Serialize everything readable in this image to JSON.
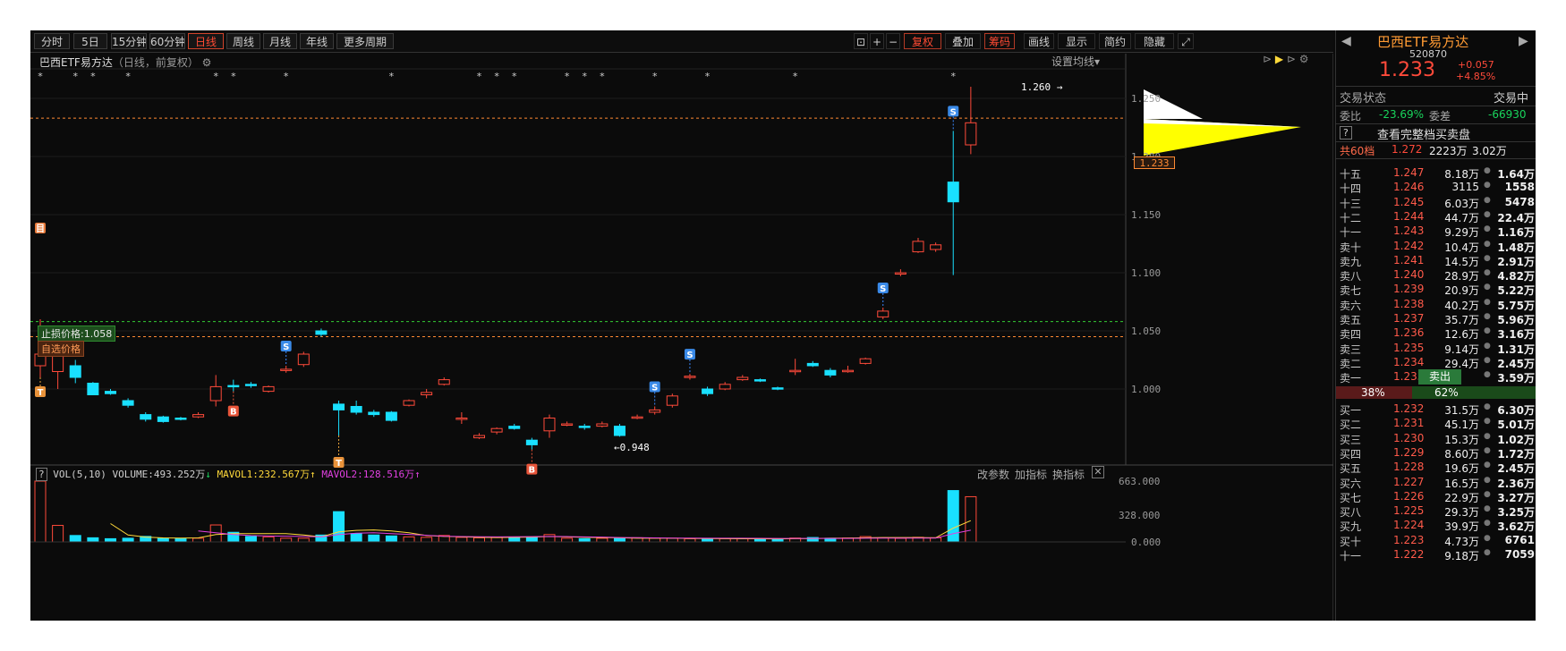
{
  "toolbar": {
    "periods": [
      "分时",
      "5日",
      "15分钟",
      "60分钟",
      "日线",
      "周线",
      "月线",
      "年线",
      "更多周期"
    ],
    "active_period": "日线",
    "right_buttons": [
      "复权",
      "叠加",
      "筹码",
      "画线",
      "显示",
      "简约",
      "隐藏"
    ],
    "zoom_in": "+",
    "zoom_out": "−"
  },
  "chart": {
    "title": "巴西ETF易方达",
    "subtitle": "（日线，前复权）",
    "settings_label": "设置均线",
    "price_axis": [
      "1.250",
      "1.200",
      "1.150",
      "1.100",
      "1.050",
      "1.000"
    ],
    "last_price_tag": "1.233",
    "high_label": "1.260",
    "low_label": "0.948",
    "stop_price_label": "止损价格:1.058",
    "select_price_label": "自选价格",
    "volume_header": {
      "name": "VOL(5,10)",
      "volume": "VOLUME:493.252万",
      "mavol1": "MAVOL1:232.567万",
      "mavol2": "MAVOL2:128.516万"
    },
    "volume_axis": [
      "663.000",
      "328.000",
      "0.000"
    ],
    "volume_buttons": [
      "改参数",
      "加指标",
      "换指标"
    ],
    "colors": {
      "up": "#ff4a3a",
      "down": "#19e0ff",
      "ma1": "#ffd93a",
      "ma2": "#e040e0"
    }
  },
  "quote": {
    "name": "巴西ETF易方达",
    "code": "520870",
    "price": "1.233",
    "change": "+0.057",
    "change_pct": "+4.85%",
    "trade_status_label": "交易状态",
    "trade_status_value": "交易中",
    "weibi_label": "委比",
    "weibi_value": "-23.69%",
    "weicha_label": "委差",
    "weicha_value": "-66930",
    "full_book_label": "查看完整档买卖盘",
    "total_levels_label": "共60档",
    "total_price": "1.272",
    "total_vol": "2223万",
    "total_amt": "3.02万",
    "sell_pct": "38%",
    "buy_pct": "62%",
    "sell_badge": "卖出",
    "asks": [
      {
        "label": "十五",
        "price": "1.247",
        "vol": "8.18万",
        "v2": "1.64万"
      },
      {
        "label": "十四",
        "price": "1.246",
        "vol": "3115",
        "v2": "1558"
      },
      {
        "label": "十三",
        "price": "1.245",
        "vol": "6.03万",
        "v2": "5478"
      },
      {
        "label": "十二",
        "price": "1.244",
        "vol": "44.7万",
        "v2": "22.4万"
      },
      {
        "label": "十一",
        "price": "1.243",
        "vol": "9.29万",
        "v2": "1.16万"
      },
      {
        "label": "卖十",
        "price": "1.242",
        "vol": "10.4万",
        "v2": "1.48万"
      },
      {
        "label": "卖九",
        "price": "1.241",
        "vol": "14.5万",
        "v2": "2.91万"
      },
      {
        "label": "卖八",
        "price": "1.240",
        "vol": "28.9万",
        "v2": "4.82万"
      },
      {
        "label": "卖七",
        "price": "1.239",
        "vol": "20.9万",
        "v2": "5.22万"
      },
      {
        "label": "卖六",
        "price": "1.238",
        "vol": "40.2万",
        "v2": "5.75万"
      },
      {
        "label": "卖五",
        "price": "1.237",
        "vol": "35.7万",
        "v2": "5.96万"
      },
      {
        "label": "卖四",
        "price": "1.236",
        "vol": "12.6万",
        "v2": "3.16万"
      },
      {
        "label": "卖三",
        "price": "1.235",
        "vol": "9.14万",
        "v2": "1.31万"
      },
      {
        "label": "卖二",
        "price": "1.234",
        "vol": "29.4万",
        "v2": "2.45万"
      },
      {
        "label": "卖一",
        "price": "1.233",
        "vol": "",
        "v2": "3.59万"
      }
    ],
    "bids": [
      {
        "label": "买一",
        "price": "1.232",
        "vol": "31.5万",
        "v2": "6.30万"
      },
      {
        "label": "买二",
        "price": "1.231",
        "vol": "45.1万",
        "v2": "5.01万"
      },
      {
        "label": "买三",
        "price": "1.230",
        "vol": "15.3万",
        "v2": "1.02万"
      },
      {
        "label": "买四",
        "price": "1.229",
        "vol": "8.60万",
        "v2": "1.72万"
      },
      {
        "label": "买五",
        "price": "1.228",
        "vol": "19.6万",
        "v2": "2.45万"
      },
      {
        "label": "买六",
        "price": "1.227",
        "vol": "16.5万",
        "v2": "2.36万"
      },
      {
        "label": "买七",
        "price": "1.226",
        "vol": "22.9万",
        "v2": "3.27万"
      },
      {
        "label": "买八",
        "price": "1.225",
        "vol": "29.3万",
        "v2": "3.25万"
      },
      {
        "label": "买九",
        "price": "1.224",
        "vol": "39.9万",
        "v2": "3.62万"
      },
      {
        "label": "买十",
        "price": "1.223",
        "vol": "4.73万",
        "v2": "6761"
      },
      {
        "label": "十一",
        "price": "1.222",
        "vol": "9.18万",
        "v2": "7059"
      }
    ]
  },
  "chart_data": {
    "type": "candlestick",
    "ylim": [
      0.93,
      1.27
    ],
    "candles": [
      [
        1.02,
        1.03,
        1.01,
        1.06
      ],
      [
        1.015,
        1.03,
        1.0,
        1.03
      ],
      [
        1.02,
        1.01,
        1.005,
        1.025
      ],
      [
        1.005,
        0.995,
        0.995,
        1.006
      ],
      [
        0.998,
        0.996,
        0.995,
        1.0
      ],
      [
        0.99,
        0.986,
        0.984,
        0.992
      ],
      [
        0.978,
        0.974,
        0.972,
        0.98
      ],
      [
        0.976,
        0.972,
        0.971,
        0.977
      ],
      [
        0.975,
        0.974,
        0.973,
        0.976
      ],
      [
        0.976,
        0.978,
        0.975,
        0.98
      ],
      [
        0.99,
        1.002,
        0.985,
        1.012
      ],
      [
        1.003,
        1.002,
        0.998,
        1.008
      ],
      [
        1.004,
        1.003,
        1.001,
        1.006
      ],
      [
        0.998,
        1.002,
        0.997,
        1.003
      ],
      [
        1.016,
        1.017,
        1.014,
        1.02
      ],
      [
        1.021,
        1.03,
        1.019,
        1.032
      ],
      [
        1.05,
        1.047,
        1.045,
        1.052
      ],
      [
        0.987,
        0.982,
        0.96,
        0.99
      ],
      [
        0.985,
        0.98,
        0.978,
        0.99
      ],
      [
        0.98,
        0.978,
        0.976,
        0.982
      ],
      [
        0.98,
        0.973,
        0.972,
        0.981
      ],
      [
        0.986,
        0.99,
        0.985,
        0.991
      ],
      [
        0.995,
        0.997,
        0.992,
        1.0
      ],
      [
        1.004,
        1.008,
        1.003,
        1.01
      ],
      [
        0.975,
        0.975,
        0.97,
        0.98
      ],
      [
        0.958,
        0.96,
        0.957,
        0.962
      ],
      [
        0.963,
        0.966,
        0.961,
        0.967
      ],
      [
        0.968,
        0.966,
        0.965,
        0.97
      ],
      [
        0.956,
        0.952,
        0.948,
        0.958
      ],
      [
        0.964,
        0.975,
        0.958,
        0.978
      ],
      [
        0.97,
        0.97,
        0.968,
        0.972
      ],
      [
        0.968,
        0.967,
        0.965,
        0.97
      ],
      [
        0.968,
        0.97,
        0.967,
        0.972
      ],
      [
        0.968,
        0.96,
        0.959,
        0.97
      ],
      [
        0.975,
        0.976,
        0.974,
        0.978
      ],
      [
        0.98,
        0.982,
        0.978,
        0.985
      ],
      [
        0.986,
        0.994,
        0.984,
        0.996
      ],
      [
        1.01,
        1.011,
        1.008,
        1.013
      ],
      [
        1.0,
        0.996,
        0.994,
        1.002
      ],
      [
        1.0,
        1.004,
        0.999,
        1.006
      ],
      [
        1.008,
        1.01,
        1.007,
        1.012
      ],
      [
        1.008,
        1.007,
        1.006,
        1.009
      ],
      [
        1.001,
        1.0,
        0.999,
        1.002
      ],
      [
        1.015,
        1.016,
        1.012,
        1.026
      ],
      [
        1.022,
        1.02,
        1.019,
        1.024
      ],
      [
        1.016,
        1.012,
        1.01,
        1.018
      ],
      [
        1.016,
        1.016,
        1.014,
        1.02
      ],
      [
        1.022,
        1.026,
        1.021,
        1.027
      ],
      [
        1.062,
        1.067,
        1.06,
        1.07
      ],
      [
        1.099,
        1.1,
        1.097,
        1.103
      ],
      [
        1.118,
        1.127,
        1.117,
        1.13
      ],
      [
        1.12,
        1.124,
        1.118,
        1.126
      ],
      [
        1.178,
        1.161,
        1.098,
        1.222
      ],
      [
        1.21,
        1.229,
        1.202,
        1.26
      ]
    ],
    "volumes": [
      663,
      180,
      70,
      45,
      35,
      40,
      60,
      40,
      38,
      40,
      185,
      105,
      60,
      55,
      40,
      40,
      75,
      330,
      90,
      75,
      65,
      55,
      50,
      70,
      50,
      45,
      48,
      50,
      55,
      80,
      40,
      35,
      40,
      38,
      45,
      42,
      40,
      35,
      30,
      35,
      38,
      30,
      32,
      42,
      48,
      40,
      42,
      58,
      45,
      40,
      50,
      45,
      560,
      493
    ],
    "mavol1": [
      null,
      null,
      null,
      null,
      200,
      75,
      52,
      44,
      42,
      44,
      80,
      90,
      90,
      90,
      90,
      75,
      55,
      110,
      125,
      130,
      120,
      100,
      70,
      60,
      55,
      50,
      48,
      50,
      52,
      58,
      55,
      50,
      48,
      45,
      40,
      40,
      40,
      38,
      36,
      35,
      34,
      34,
      33,
      35,
      37,
      40,
      42,
      45,
      48,
      47,
      47,
      45,
      150,
      232
    ],
    "mavol2": [
      null,
      null,
      null,
      null,
      null,
      null,
      null,
      null,
      null,
      120,
      100,
      80,
      70,
      65,
      62,
      60,
      55,
      80,
      95,
      100,
      90,
      82,
      72,
      62,
      58,
      56,
      55,
      56,
      57,
      60,
      58,
      55,
      52,
      48,
      46,
      44,
      42,
      41,
      40,
      40,
      40,
      39,
      38,
      38,
      38,
      38,
      38,
      40,
      42,
      42,
      42,
      42,
      90,
      128
    ],
    "markers": [
      {
        "i": 0,
        "type": "B_top"
      },
      {
        "i": 0,
        "type": "T"
      },
      {
        "i": 11,
        "type": "B"
      },
      {
        "i": 14,
        "type": "S"
      },
      {
        "i": 17,
        "type": "T"
      },
      {
        "i": 28,
        "type": "B"
      },
      {
        "i": 35,
        "type": "S"
      },
      {
        "i": 37,
        "type": "S"
      },
      {
        "i": 48,
        "type": "S"
      },
      {
        "i": 52,
        "type": "S"
      }
    ]
  }
}
